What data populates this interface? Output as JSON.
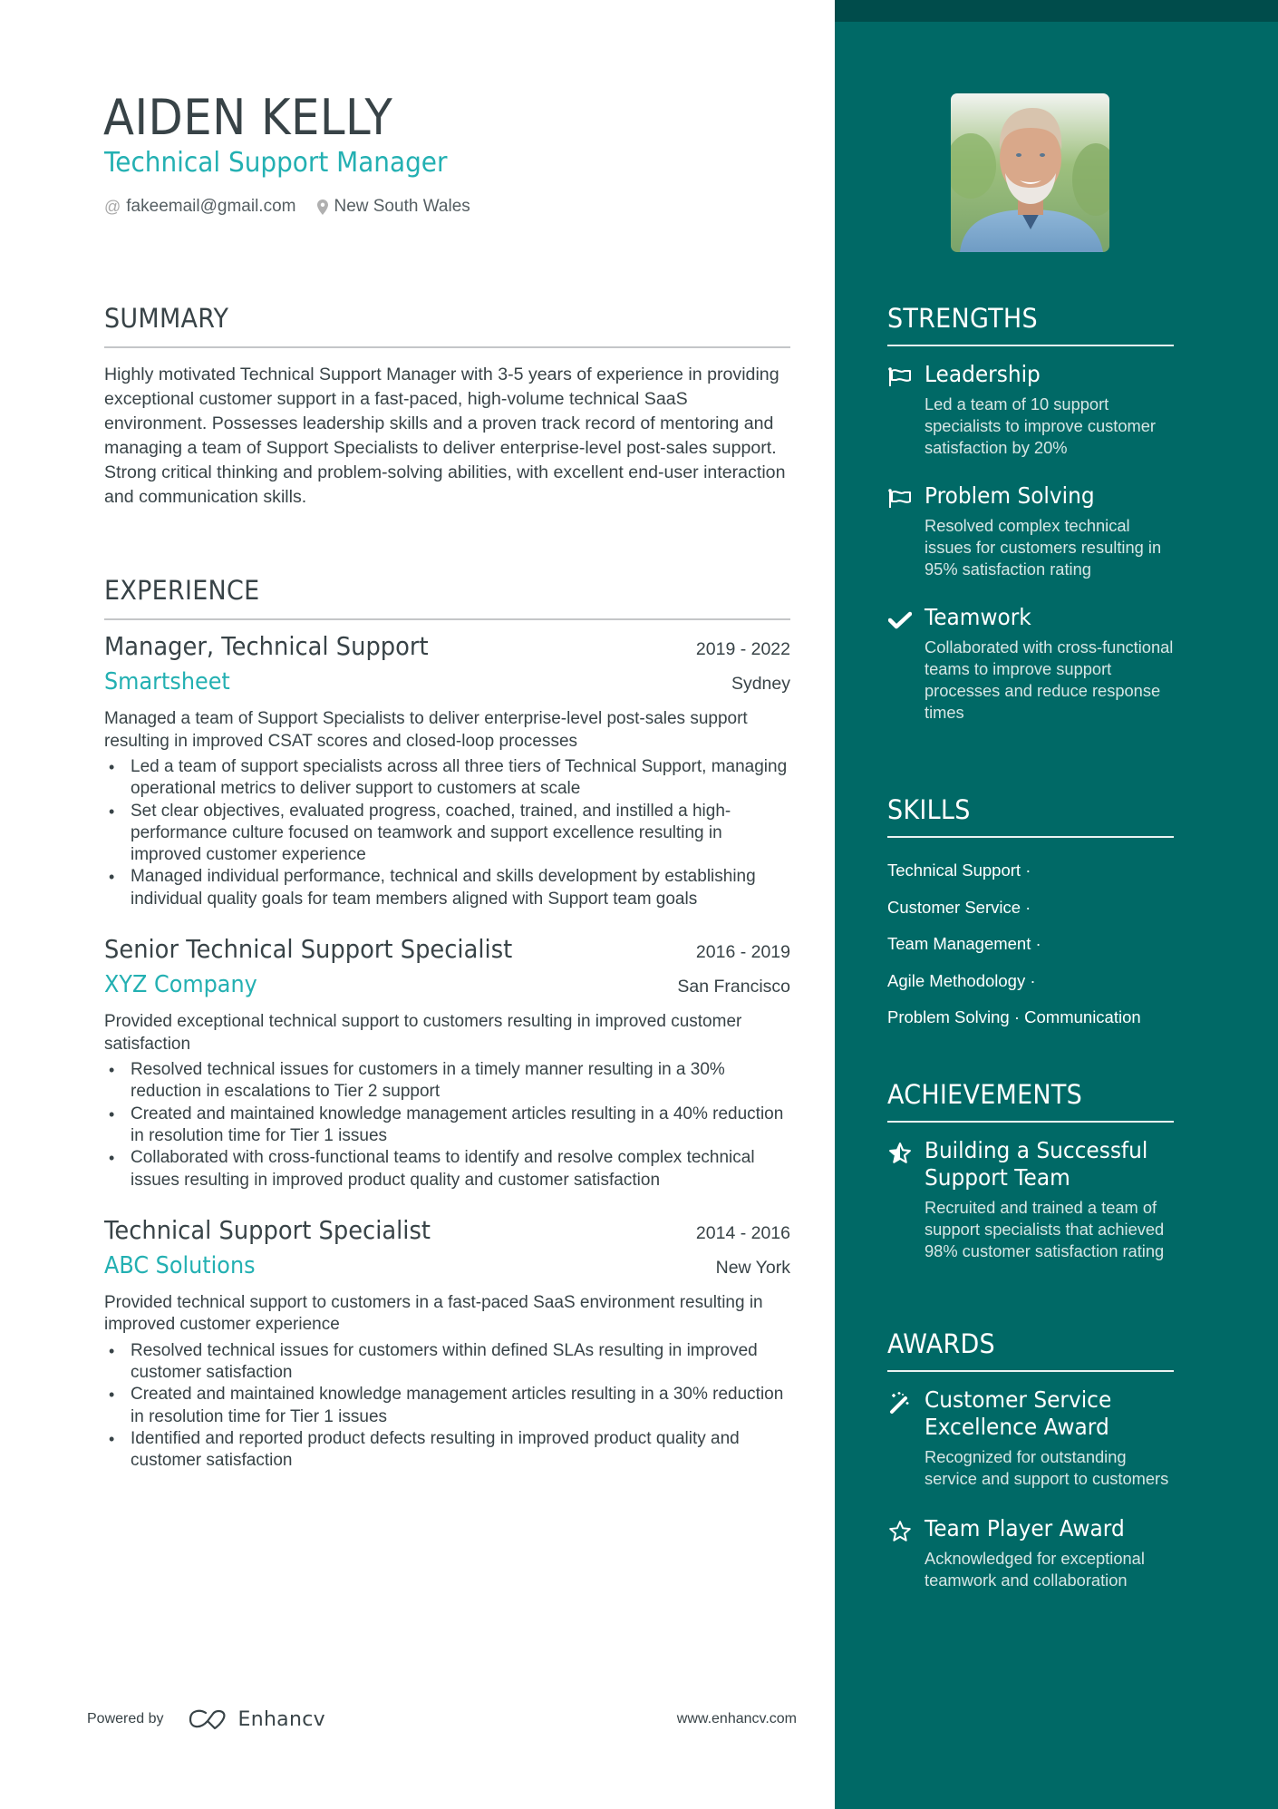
{
  "header": {
    "name": "AIDEN KELLY",
    "title": "Technical Support Manager",
    "email": "fakeemail@gmail.com",
    "location": "New South Wales",
    "email_icon": "at-icon",
    "location_icon": "map-pin-icon"
  },
  "summary": {
    "heading": "SUMMARY",
    "text": "Highly motivated Technical Support Manager with 3-5 years of experience in providing exceptional customer support in a fast-paced, high-volume technical SaaS environment. Possesses leadership skills and a proven track record of mentoring and managing a team of Support Specialists to deliver enterprise-level post-sales support. Strong critical thinking and problem-solving abilities, with excellent end-user interaction and communication skills."
  },
  "experience": {
    "heading": "EXPERIENCE",
    "jobs": [
      {
        "role": "Manager, Technical Support",
        "dates": "2019 - 2022",
        "company": "Smartsheet",
        "location": "Sydney",
        "description": "Managed a team of Support Specialists to deliver enterprise-level post-sales support resulting in improved CSAT scores and closed-loop processes",
        "bullets": [
          "Led a team of support specialists across all three tiers of Technical Support, managing operational metrics to deliver support to customers at scale",
          "Set clear objectives, evaluated progress, coached, trained, and instilled a high-performance culture focused on teamwork and support excellence resulting in improved customer experience",
          "Managed individual performance, technical and skills development by establishing individual quality goals for team members aligned with Support team goals"
        ]
      },
      {
        "role": "Senior Technical Support Specialist",
        "dates": "2016 - 2019",
        "company": "XYZ Company",
        "location": "San Francisco",
        "description": "Provided exceptional technical support to customers resulting in improved customer satisfaction",
        "bullets": [
          "Resolved technical issues for customers in a timely manner resulting in a 30% reduction in escalations to Tier 2 support",
          "Created and maintained knowledge management articles resulting in a 40% reduction in resolution time for Tier 1 issues",
          "Collaborated with cross-functional teams to identify and resolve complex technical issues resulting in improved product quality and customer satisfaction"
        ]
      },
      {
        "role": "Technical Support Specialist",
        "dates": "2014 - 2016",
        "company": "ABC Solutions",
        "location": "New York",
        "description": "Provided technical support to customers in a fast-paced SaaS environment resulting in improved customer experience",
        "bullets": [
          "Resolved technical issues for customers within defined SLAs resulting in improved customer satisfaction",
          "Created and maintained knowledge management articles resulting in a 30% reduction in resolution time for Tier 1 issues",
          "Identified and reported product defects resulting in improved product quality and customer satisfaction"
        ]
      }
    ]
  },
  "footer": {
    "powered_by": "Powered by",
    "brand": "Enhancv",
    "website": "www.enhancv.com"
  },
  "sidebar": {
    "photo_alt": "Profile photo of Aiden Kelly",
    "strengths": {
      "heading": "STRENGTHS",
      "items": [
        {
          "icon": "flag-icon",
          "title": "Leadership",
          "description": "Led a team of 10 support specialists to improve customer satisfaction by 20%"
        },
        {
          "icon": "flag-icon",
          "title": "Problem Solving",
          "description": "Resolved complex technical issues for customers resulting in 95% satisfaction rating"
        },
        {
          "icon": "checkmark-icon",
          "title": "Teamwork",
          "description": "Collaborated with cross-functional teams to improve support processes and reduce response times"
        }
      ]
    },
    "skills": {
      "heading": "SKILLS",
      "lines": [
        "Technical Support ·",
        "Customer Service ·",
        "Team Management ·",
        "Agile Methodology ·",
        "Problem Solving · Communication"
      ]
    },
    "achievements": {
      "heading": "ACHIEVEMENTS",
      "items": [
        {
          "icon": "star-half-icon",
          "title": "Building a Successful Support Team",
          "description": "Recruited and trained a team of support specialists that achieved 98% customer satisfaction rating"
        }
      ]
    },
    "awards": {
      "heading": "AWARDS",
      "items": [
        {
          "icon": "magic-wand-icon",
          "title": "Customer Service Excellence Award",
          "description": "Recognized for outstanding service and support to customers"
        },
        {
          "icon": "star-outline-icon",
          "title": "Team Player Award",
          "description": "Acknowledged for exceptional teamwork and collaboration"
        }
      ]
    }
  },
  "colors": {
    "accent": "#23b0b2",
    "sidebar": "#006966",
    "sidebar_band": "#004c4b",
    "text": "#384347"
  }
}
